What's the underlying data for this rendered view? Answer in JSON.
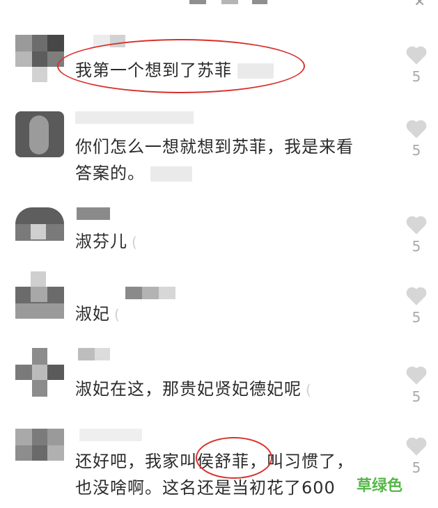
{
  "comments": [
    {
      "text": [
        "我第一个想到了苏菲"
      ],
      "likes": "5"
    },
    {
      "text": [
        "你们怎么一想就想到苏菲，我是来看",
        "答案的。"
      ],
      "likes": "5"
    },
    {
      "text": [
        "淑芬儿"
      ],
      "likes": "5"
    },
    {
      "text": [
        "淑妃"
      ],
      "likes": "5"
    },
    {
      "text": [
        "淑妃在这，那贵妃贤妃德妃呢"
      ],
      "likes": "5"
    },
    {
      "text": [
        "还好吧，我家叫侯舒菲，叫习惯了，",
        "也没啥啊。这名还是当初花了600"
      ],
      "likes": "5"
    }
  ],
  "watermark": "草绿色",
  "colors": {
    "annotation": "#d9302b",
    "watermark": "#55b848",
    "like": "#d6d6d6"
  },
  "icons": {
    "like": "heart-icon",
    "close": "close-icon"
  }
}
